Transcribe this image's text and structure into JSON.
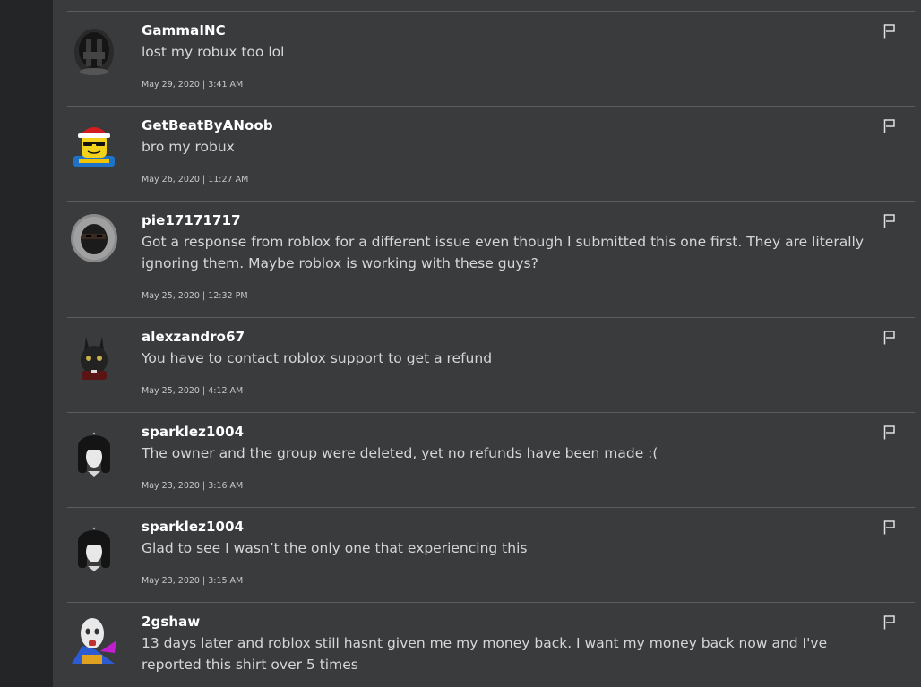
{
  "comments": [
    {
      "username": "GammaINC",
      "text": "lost my robux too lol",
      "date": "May 29, 2020 | 3:41 AM",
      "avatar_icon": "avatar-black-helmet"
    },
    {
      "username": "GetBeatByANoob",
      "text": "bro my robux",
      "date": "May 26, 2020 | 11:27 AM",
      "avatar_icon": "avatar-santa-sunglasses"
    },
    {
      "username": "pie17171717",
      "text": "Got a response from roblox for a different issue even though I submitted this one first. They are literally ignoring them. Maybe roblox is working with these guys?",
      "date": "May 25, 2020 | 12:32 PM",
      "avatar_icon": "avatar-fur-hood"
    },
    {
      "username": "alexzandro67",
      "text": "You have to contact roblox support to get a refund",
      "date": "May 25, 2020 | 4:12 AM",
      "avatar_icon": "avatar-bunny-ears"
    },
    {
      "username": "sparklez1004",
      "text": "The owner and the group were deleted, yet no refunds have been made :(",
      "date": "May 23, 2020 | 3:16 AM",
      "avatar_icon": "avatar-long-black-hair"
    },
    {
      "username": "sparklez1004",
      "text": "Glad to see I wasn’t the only one that experiencing this",
      "date": "May 23, 2020 | 3:15 AM",
      "avatar_icon": "avatar-long-black-hair"
    },
    {
      "username": "2gshaw",
      "text": "13 days later and roblox still hasnt given me my money back. I want my money back now and I've reported this shirt over 5 times",
      "date": "",
      "avatar_icon": "avatar-pale-mask"
    }
  ],
  "flag_icon": "flag-icon",
  "colors": {
    "background": "#393b3d",
    "rail": "#232527",
    "divider": "#5a5c5e",
    "username": "#ffffff",
    "text": "#d6d6d6"
  }
}
